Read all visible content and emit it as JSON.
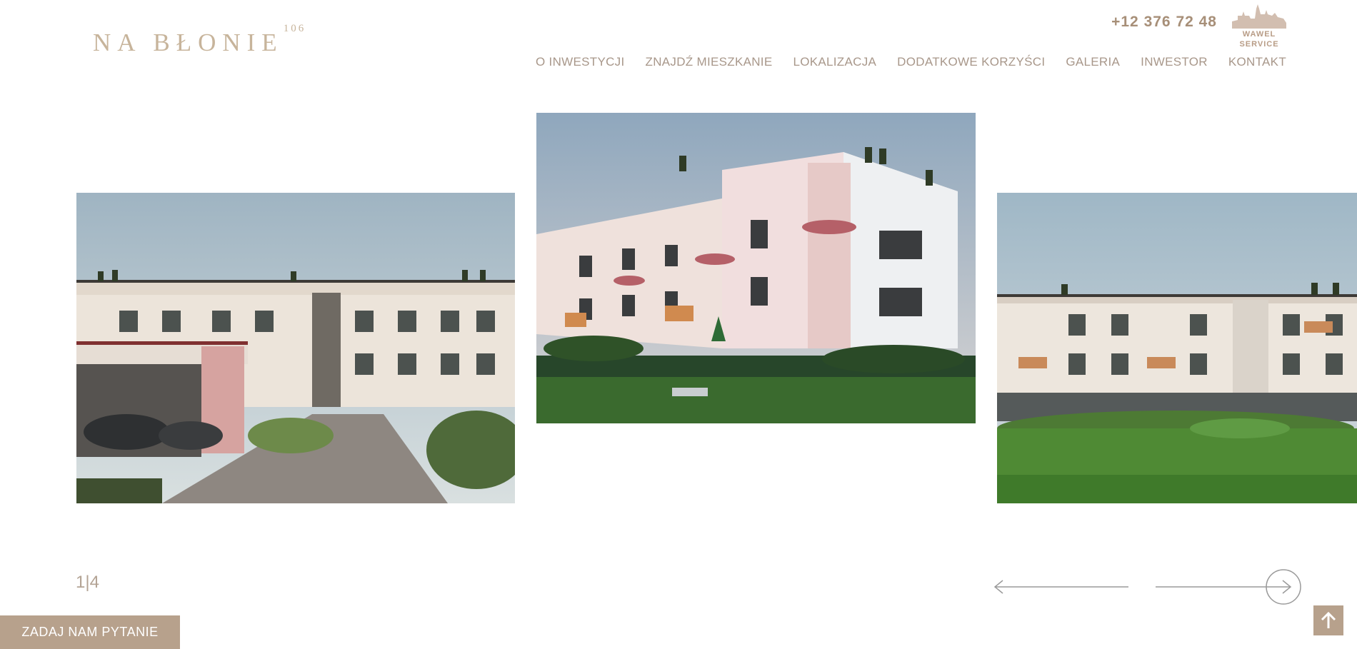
{
  "header": {
    "logo_text": "NA BŁONIE",
    "logo_sup": "106",
    "phone": "+12 376 72 48",
    "brand_word1": "WAWEL",
    "brand_word2": "SERVICE"
  },
  "nav": {
    "items": [
      {
        "label": "O INWESTYCJI"
      },
      {
        "label": "ZNAJDŹ MIESZKANIE"
      },
      {
        "label": "LOKALIZACJA"
      },
      {
        "label": "DODATKOWE KORZYŚCI"
      },
      {
        "label": "GALERIA"
      },
      {
        "label": "INWESTOR"
      },
      {
        "label": "KONTAKT"
      }
    ]
  },
  "slider": {
    "current": "1",
    "separator": "|",
    "total": "4"
  },
  "cta": {
    "ask_label": "ZADAJ NAM PYTANIE"
  },
  "colors": {
    "accent": "#b7a18c",
    "logo": "#c7b49b",
    "nav_text": "#a8978a"
  },
  "icons": {
    "prev": "arrow-left-icon",
    "next": "arrow-right-icon",
    "top": "arrow-up-icon",
    "brand": "wawel-castle-icon"
  }
}
